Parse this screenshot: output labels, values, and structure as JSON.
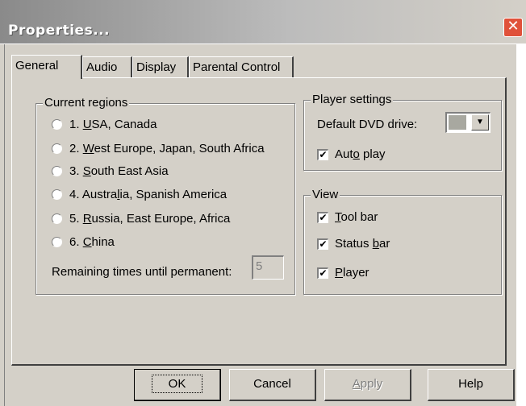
{
  "window": {
    "title": "Properties...",
    "close_glyph": "✕",
    "close_icon": "close-icon"
  },
  "tabs": [
    {
      "label": "General",
      "active": true
    },
    {
      "label": "Audio",
      "active": false
    },
    {
      "label": "Display",
      "active": false
    },
    {
      "label": "Parental Control",
      "active": false
    }
  ],
  "regions": {
    "group_label": "Current regions",
    "options": [
      {
        "num": "1. ",
        "acc": "U",
        "rest": "SA, Canada"
      },
      {
        "num": "2. ",
        "acc": "W",
        "rest": "est Europe, Japan, South Africa"
      },
      {
        "num": "3. ",
        "acc": "S",
        "rest": "outh East Asia"
      },
      {
        "num": "4. Austra",
        "acc": "l",
        "rest": "ia, Spanish America"
      },
      {
        "num": "5. ",
        "acc": "R",
        "rest": "ussia, East Europe, Africa"
      },
      {
        "num": "6. ",
        "acc": "C",
        "rest": "hina"
      }
    ],
    "remaining_label": "Remaining times until permanent:",
    "remaining_value": "5"
  },
  "player": {
    "group_label": "Player settings",
    "drive_label": "Default DVD drive:",
    "drive_value": "",
    "autoplay_pre": "Aut",
    "autoplay_acc": "o",
    "autoplay_post": " play",
    "autoplay_checked": true
  },
  "view": {
    "group_label": "View",
    "toolbar_acc": "T",
    "toolbar_rest": "ool bar",
    "statusbar_pre": "Status ",
    "statusbar_acc": "b",
    "statusbar_post": "ar",
    "player_acc": "P",
    "player_rest": "layer",
    "check_glyph": "✔"
  },
  "buttons": {
    "ok": "OK",
    "cancel": "Cancel",
    "apply_acc": "A",
    "apply_rest": "pply",
    "help": "Help"
  }
}
